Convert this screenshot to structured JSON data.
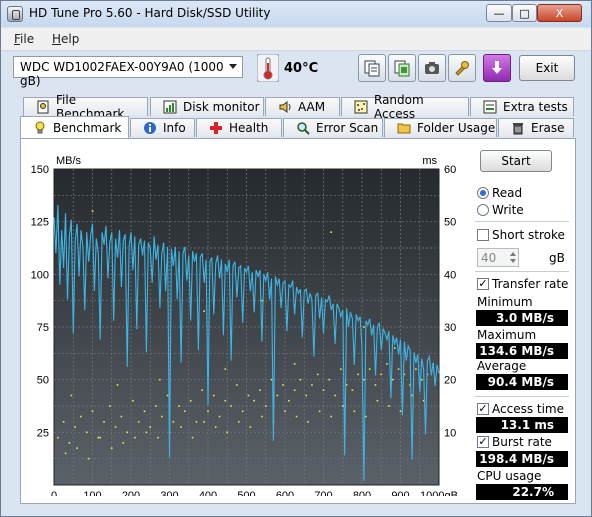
{
  "window": {
    "title": "HD Tune Pro 5.60 - Hard Disk/SSD Utility"
  },
  "window_controls": {
    "minimize": "—",
    "maximize": "□",
    "close": "X"
  },
  "menu": [
    {
      "label": "File",
      "underline": "F",
      "rest": "ile"
    },
    {
      "label": "Help",
      "underline": "H",
      "rest": "elp"
    }
  ],
  "toolbar": {
    "drive": "WDC WD1002FAEX-00Y9A0 (1000 gB)",
    "temperature": "40°C",
    "exit_label": "Exit",
    "icons": [
      "copy-text-icon",
      "copy-screenshot-icon",
      "camera-icon",
      "settings-icon",
      "download-icon"
    ]
  },
  "tabs_row1": [
    {
      "label": "File Benchmark",
      "icon": "file-benchmark-icon"
    },
    {
      "label": "Disk monitor",
      "icon": "disk-monitor-icon"
    },
    {
      "label": "AAM",
      "icon": "speaker-icon"
    },
    {
      "label": "Random Access",
      "icon": "random-access-icon"
    },
    {
      "label": "Extra tests",
      "icon": "extra-tests-icon"
    }
  ],
  "tabs_row2": [
    {
      "label": "Benchmark",
      "icon": "lightbulb-icon"
    },
    {
      "label": "Info",
      "icon": "info-icon"
    },
    {
      "label": "Health",
      "icon": "health-cross-icon"
    },
    {
      "label": "Error Scan",
      "icon": "magnifier-icon"
    },
    {
      "label": "Folder Usage",
      "icon": "folder-icon"
    },
    {
      "label": "Erase",
      "icon": "trash-icon"
    }
  ],
  "side_panel": {
    "start_label": "Start",
    "read_label": "Read",
    "write_label": "Write",
    "short_stroke_label": "Short stroke",
    "short_stroke_value": "40",
    "short_stroke_unit": "gB",
    "transfer_rate_label": "Transfer rate",
    "minimum_label": "Minimum",
    "minimum_value": "3.0 MB/s",
    "maximum_label": "Maximum",
    "maximum_value": "134.6 MB/s",
    "average_label": "Average",
    "average_value": "90.4 MB/s",
    "access_time_label": "Access time",
    "access_time_value": "13.1 ms",
    "burst_rate_label": "Burst rate",
    "burst_rate_value": "198.4 MB/s",
    "cpu_usage_label": "CPU usage",
    "cpu_usage_value": "22.7%"
  },
  "chart_data": {
    "type": "line",
    "y_left_label": "MB/s",
    "y_right_label": "ms",
    "x_unit": "gB",
    "ylim_left": [
      0,
      150
    ],
    "ylim_right": [
      0,
      60
    ],
    "xlim": [
      0,
      1000
    ],
    "y_left_ticks": [
      25,
      50,
      75,
      100,
      125,
      150
    ],
    "y_right_ticks": [
      10,
      20,
      30,
      40,
      50,
      60
    ],
    "x_ticks": [
      0,
      100,
      200,
      300,
      400,
      500,
      600,
      700,
      800,
      900,
      1000
    ],
    "grid": true,
    "series": [
      {
        "color": "#3cb6e6",
        "x": [
          0,
          5,
          10,
          15,
          20,
          25,
          30,
          35,
          40,
          45,
          50,
          55,
          60,
          65,
          70,
          75,
          80,
          85,
          90,
          95,
          100,
          105,
          110,
          115,
          120,
          125,
          130,
          135,
          140,
          145,
          150,
          155,
          160,
          165,
          170,
          175,
          180,
          185,
          190,
          195,
          200,
          205,
          210,
          215,
          220,
          225,
          230,
          235,
          240,
          245,
          250,
          255,
          260,
          265,
          270,
          275,
          280,
          285,
          290,
          295,
          300,
          305,
          310,
          315,
          320,
          325,
          330,
          335,
          340,
          345,
          350,
          355,
          360,
          365,
          370,
          375,
          380,
          385,
          390,
          395,
          400,
          405,
          410,
          415,
          420,
          425,
          430,
          435,
          440,
          445,
          450,
          455,
          460,
          465,
          470,
          475,
          480,
          485,
          490,
          495,
          500,
          505,
          510,
          515,
          520,
          525,
          530,
          535,
          540,
          545,
          550,
          555,
          560,
          565,
          570,
          575,
          580,
          585,
          590,
          595,
          600,
          605,
          610,
          615,
          620,
          625,
          630,
          635,
          640,
          645,
          650,
          655,
          660,
          665,
          670,
          675,
          680,
          685,
          690,
          695,
          700,
          705,
          710,
          715,
          720,
          725,
          730,
          735,
          740,
          745,
          750,
          755,
          760,
          765,
          770,
          775,
          780,
          785,
          790,
          795,
          800,
          805,
          810,
          815,
          820,
          825,
          830,
          835,
          840,
          845,
          850,
          855,
          860,
          865,
          870,
          875,
          880,
          885,
          890,
          895,
          900,
          905,
          910,
          915,
          920,
          925,
          930,
          935,
          940,
          945,
          950,
          955,
          960,
          965,
          970,
          975,
          980,
          985,
          990,
          995,
          1000
        ],
        "values": [
          127,
          110,
          133,
          95,
          121,
          103,
          129,
          88,
          118,
          126,
          72,
          116,
          124,
          99,
          121,
          113,
          83,
          120,
          106,
          118,
          124,
          92,
          117,
          110,
          69,
          120,
          114,
          123,
          98,
          115,
          120,
          78,
          117,
          108,
          121,
          94,
          116,
          119,
          56,
          113,
          120,
          102,
          118,
          74,
          114,
          117,
          109,
          116,
          63,
          115,
          112,
          96,
          118,
          107,
          114,
          84,
          110,
          115,
          92,
          113,
          13,
          112,
          104,
          113,
          88,
          111,
          58,
          110,
          113,
          97,
          109,
          78,
          111,
          106,
          110,
          64,
          108,
          110,
          96,
          107,
          38,
          106,
          108,
          81,
          105,
          109,
          98,
          107,
          71,
          105,
          101,
          107,
          59,
          104,
          106,
          89,
          103,
          104,
          77,
          103,
          101,
          104,
          92,
          101,
          82,
          102,
          99,
          102,
          68,
          100,
          97,
          101,
          88,
          98,
          21,
          99,
          95,
          98,
          84,
          96,
          97,
          73,
          95,
          94,
          97,
          81,
          94,
          91,
          93,
          70,
          92,
          93,
          86,
          91,
          88,
          61,
          90,
          91,
          79,
          89,
          72,
          88,
          87,
          90,
          83,
          86,
          67,
          86,
          84,
          80,
          83,
          14,
          84,
          75,
          82,
          79,
          57,
          81,
          78,
          80,
          65,
          2,
          78,
          76,
          79,
          71,
          76,
          52,
          75,
          77,
          64,
          74,
          72,
          69,
          73,
          41,
          71,
          67,
          70,
          62,
          69,
          33,
          68,
          59,
          66,
          64,
          12,
          63,
          58,
          62,
          44,
          60,
          55,
          24,
          59,
          61,
          52,
          58,
          47,
          57,
          53
        ]
      },
      {
        "color": "#e8e84a",
        "axis": "right",
        "points": [
          [
            10,
            9
          ],
          [
            25,
            12
          ],
          [
            40,
            8
          ],
          [
            55,
            11
          ],
          [
            70,
            13
          ],
          [
            85,
            10
          ],
          [
            100,
            14
          ],
          [
            115,
            9
          ],
          [
            130,
            12
          ],
          [
            145,
            15
          ],
          [
            160,
            11
          ],
          [
            175,
            13
          ],
          [
            190,
            10
          ],
          [
            205,
            16
          ],
          [
            220,
            12
          ],
          [
            235,
            14
          ],
          [
            250,
            11
          ],
          [
            265,
            15
          ],
          [
            280,
            13
          ],
          [
            295,
            17
          ],
          [
            310,
            12
          ],
          [
            325,
            15
          ],
          [
            340,
            14
          ],
          [
            355,
            16
          ],
          [
            370,
            12
          ],
          [
            385,
            18
          ],
          [
            400,
            14
          ],
          [
            415,
            17
          ],
          [
            430,
            13
          ],
          [
            445,
            16
          ],
          [
            460,
            15
          ],
          [
            475,
            19
          ],
          [
            490,
            14
          ],
          [
            505,
            17
          ],
          [
            520,
            16
          ],
          [
            535,
            18
          ],
          [
            550,
            15
          ],
          [
            565,
            20
          ],
          [
            580,
            17
          ],
          [
            595,
            19
          ],
          [
            610,
            16
          ],
          [
            625,
            18
          ],
          [
            640,
            20
          ],
          [
            655,
            17
          ],
          [
            670,
            19
          ],
          [
            685,
            21
          ],
          [
            700,
            18
          ],
          [
            715,
            20
          ],
          [
            730,
            17
          ],
          [
            745,
            22
          ],
          [
            760,
            19
          ],
          [
            775,
            18
          ],
          [
            790,
            21
          ],
          [
            805,
            20
          ],
          [
            820,
            22
          ],
          [
            835,
            19
          ],
          [
            850,
            21
          ],
          [
            865,
            23
          ],
          [
            880,
            20
          ],
          [
            895,
            22
          ],
          [
            910,
            21
          ],
          [
            925,
            19
          ],
          [
            940,
            22
          ],
          [
            955,
            20
          ],
          [
            970,
            21
          ],
          [
            985,
            23
          ],
          [
            30,
            6
          ],
          [
            60,
            7
          ],
          [
            90,
            5
          ],
          [
            120,
            9
          ],
          [
            150,
            7
          ],
          [
            180,
            8
          ],
          [
            210,
            9
          ],
          [
            240,
            10
          ],
          [
            270,
            9
          ],
          [
            300,
            10
          ],
          [
            330,
            11
          ],
          [
            360,
            9
          ],
          [
            390,
            12
          ],
          [
            420,
            11
          ],
          [
            450,
            10
          ],
          [
            480,
            12
          ],
          [
            510,
            11
          ],
          [
            540,
            13
          ],
          [
            570,
            12
          ],
          [
            600,
            14
          ],
          [
            630,
            13
          ],
          [
            660,
            12
          ],
          [
            690,
            14
          ],
          [
            720,
            13
          ],
          [
            750,
            15
          ],
          [
            780,
            14
          ],
          [
            810,
            13
          ],
          [
            840,
            16
          ],
          [
            870,
            15
          ],
          [
            900,
            14
          ],
          [
            930,
            17
          ],
          [
            960,
            16
          ],
          [
            100,
            52
          ],
          [
            540,
            35
          ],
          [
            390,
            33
          ],
          [
            720,
            48
          ],
          [
            805,
            30
          ],
          [
            45,
            17
          ],
          [
            165,
            19
          ],
          [
            275,
            20
          ],
          [
            445,
            22
          ],
          [
            625,
            23
          ],
          [
            885,
            26
          ]
        ]
      }
    ]
  }
}
